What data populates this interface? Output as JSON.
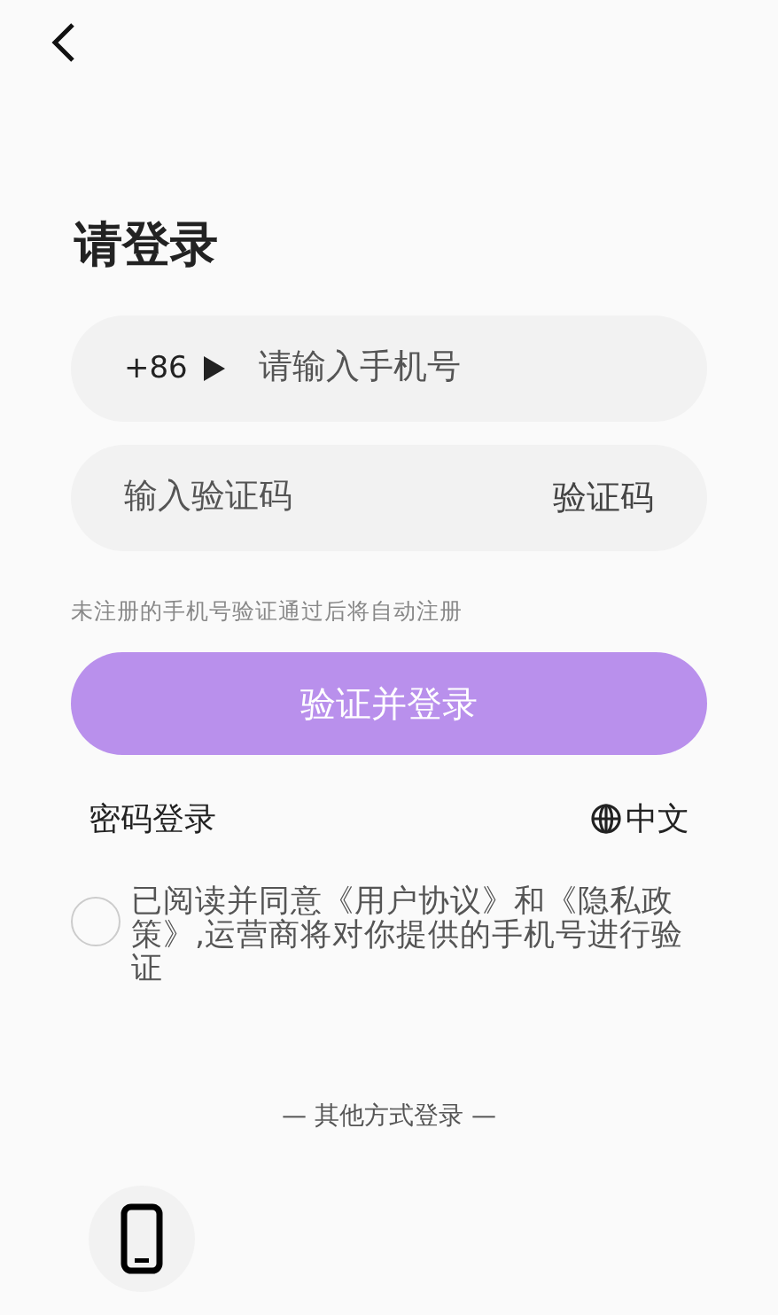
{
  "title": "请登录",
  "phone_field": {
    "country_code": "+86",
    "placeholder": "请输入手机号"
  },
  "code_field": {
    "placeholder": "输入验证码",
    "send_button": "验证码"
  },
  "hint": "未注册的手机号验证通过后将自动注册",
  "login_button": {
    "label": "验证并登录",
    "disabled": true
  },
  "password_login": "密码登录",
  "language": "中文",
  "agreement": {
    "checked": false,
    "text": "已阅读并同意《用户协议》和《隐私政策》,运营商将对你提供的手机号进行验证"
  },
  "other_methods": {
    "label": "— 其他方式登录 —",
    "options": [
      {
        "kind": "phone"
      }
    ]
  }
}
